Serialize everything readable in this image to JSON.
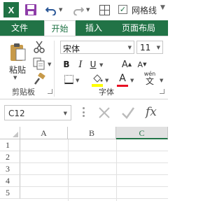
{
  "qat": {
    "app_logo": "X",
    "gridlines_label": "网格线",
    "gridlines_checked": "✓"
  },
  "tabs": {
    "file": "文件",
    "home": "开始",
    "insert": "插入",
    "page_layout": "页面布局"
  },
  "clipboard": {
    "paste_label": "粘贴",
    "group_label": "剪贴板"
  },
  "font": {
    "font_name": "宋体",
    "font_size": "11",
    "bold": "B",
    "italic": "I",
    "underline": "U",
    "grow": "A",
    "shrink": "A",
    "font_color_glyph": "A",
    "phonetic_top": "wén",
    "phonetic_bottom": "文",
    "group_label": "字体"
  },
  "formula_bar": {
    "name_box": "C12",
    "fx": "fx"
  },
  "grid": {
    "columns": [
      "A",
      "B",
      "C"
    ],
    "rows": [
      "1",
      "2",
      "3",
      "4",
      "5"
    ]
  },
  "colors": {
    "accent": "#217346",
    "font_color": "#e81123"
  }
}
